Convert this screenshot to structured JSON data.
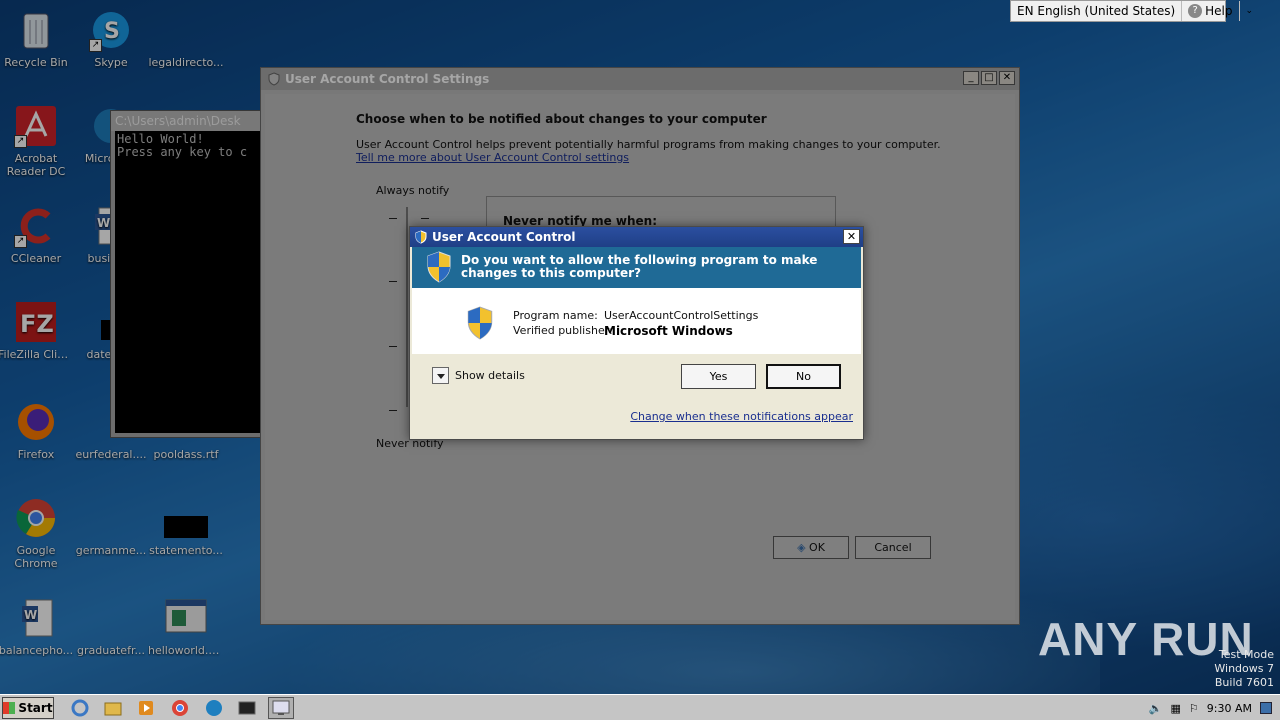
{
  "desktop": {
    "icons": [
      {
        "label": "Recycle Bin"
      },
      {
        "label": "Skype"
      },
      {
        "label": "legaldirecto..."
      },
      {
        "label": "Acrobat Reader DC"
      },
      {
        "label": "Microso..."
      },
      {
        "label": "CCleaner"
      },
      {
        "label": "busine..."
      },
      {
        "label": "FileZilla Client"
      },
      {
        "label": "dateha..."
      },
      {
        "label": "Firefox"
      },
      {
        "label": "eurfederal...."
      },
      {
        "label": "pooldass.rtf"
      },
      {
        "label": "Google Chrome"
      },
      {
        "label": "germanme..."
      },
      {
        "label": "statemento..."
      },
      {
        "label": "balancepho..."
      },
      {
        "label": "graduatefr..."
      },
      {
        "label": "helloworld.exe"
      }
    ]
  },
  "language_bar": {
    "language": "EN English (United States)",
    "help": "Help"
  },
  "console": {
    "title": "C:\\Users\\admin\\Desk",
    "line1": "Hello World!",
    "line2": "Press any key to c"
  },
  "settings_window": {
    "title": "User Account Control Settings",
    "heading": "Choose when to be notified about changes to your computer",
    "description": "User Account Control helps prevent potentially harmful programs from making changes to your computer.",
    "link": "Tell me more about User Account Control settings",
    "always_notify": "Always notify",
    "never_notify": "Never notify",
    "box_title": "Never notify me when:",
    "ok": "OK",
    "cancel": "Cancel"
  },
  "uac_prompt": {
    "title": "User Account Control",
    "question": "Do you want to allow the following program to make changes to this computer?",
    "program_label": "Program name:",
    "program_value": "UserAccountControlSettings",
    "publisher_label": "Verified publisher:",
    "publisher_value": "Microsoft Windows",
    "show_details": "Show details",
    "yes": "Yes",
    "no": "No",
    "change_link": "Change when these notifications appear"
  },
  "watermark": {
    "brand": "ANY RUN",
    "line1": "Test Mode",
    "line2": "Windows 7",
    "line3": "Build 7601"
  },
  "taskbar": {
    "start": "Start",
    "clock": "9:30 AM"
  },
  "colors": {
    "uac_banner": "#1f6a96",
    "link": "#1a2f8f",
    "desktop": "#1560a8"
  }
}
